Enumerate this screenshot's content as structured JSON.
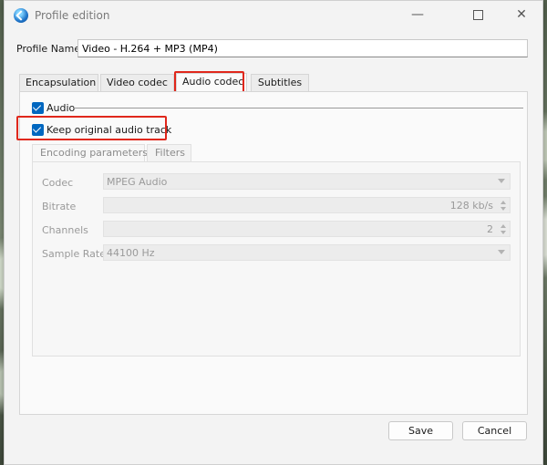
{
  "window": {
    "title": "Profile edition"
  },
  "profile": {
    "label": "Profile Name",
    "value": "Video - H.264 + MP3 (MP4)"
  },
  "tabs": [
    {
      "label": "Encapsulation"
    },
    {
      "label": "Video codec"
    },
    {
      "label": "Audio codec"
    },
    {
      "label": "Subtitles"
    }
  ],
  "audio": {
    "enable_label": "Audio",
    "keep_original_label": "Keep original audio track",
    "audio_checked": true,
    "keep_original_checked": true
  },
  "subtabs": [
    {
      "label": "Encoding parameters"
    },
    {
      "label": "Filters"
    }
  ],
  "fields": {
    "codec": {
      "label": "Codec",
      "value": "MPEG Audio"
    },
    "bitrate": {
      "label": "Bitrate",
      "value": "128 kb/s"
    },
    "channels": {
      "label": "Channels",
      "value": "2"
    },
    "sample_rate": {
      "label": "Sample Rate",
      "value": "44100 Hz"
    }
  },
  "buttons": {
    "save": "Save",
    "cancel": "Cancel"
  },
  "colors": {
    "highlight": "#e0271b",
    "checkbox": "#0067c0"
  },
  "icons": {
    "app": "vlc-globe-icon",
    "minimize": "minimize-icon",
    "maximize": "maximize-icon",
    "close": "close-icon"
  }
}
